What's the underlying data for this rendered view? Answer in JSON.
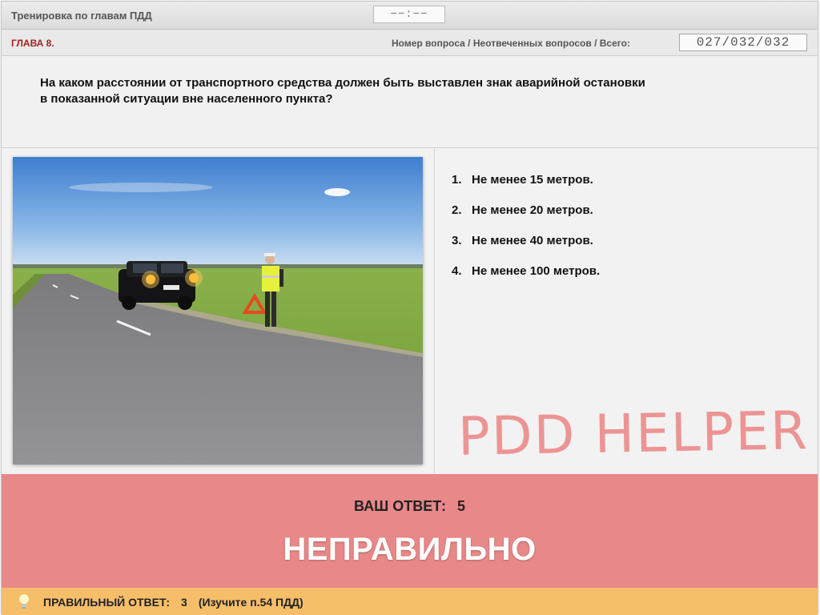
{
  "app": {
    "title": "Тренировка по главам ПДД",
    "timer": "−−:−−"
  },
  "info": {
    "chapter": "ГЛАВА 8.",
    "counter_label": "Номер вопроса / Неотвеченных вопросов / Всего:",
    "counter_value": "027/032/032"
  },
  "question": {
    "line1": "На каком расстоянии от транспортного средства должен быть выставлен знак аварийной остановки",
    "line2": "в показанной ситуации вне населенного пункта?"
  },
  "answers": [
    {
      "num": "1.",
      "text": "Не менее 15 метров."
    },
    {
      "num": "2.",
      "text": "Не менее 20 метров."
    },
    {
      "num": "3.",
      "text": "Не менее 40 метров."
    },
    {
      "num": "4.",
      "text": "Не менее 100 метров."
    }
  ],
  "watermark": "PDD HELPER",
  "result": {
    "your_answer_label": "ВАШ  ОТВЕТ:",
    "your_answer_value": "5",
    "verdict": "НЕПРАВИЛЬНО"
  },
  "hint": {
    "label": "ПРАВИЛЬНЫЙ ОТВЕТ:",
    "value": "3",
    "note": "(Изучите п.54 ПДД)",
    "icon": "lightbulb-icon"
  },
  "colors": {
    "result_band": "#e88888",
    "hint_bar": "#f7be6a",
    "chapter": "#a31f1f",
    "watermark": "#ec8f8f"
  }
}
